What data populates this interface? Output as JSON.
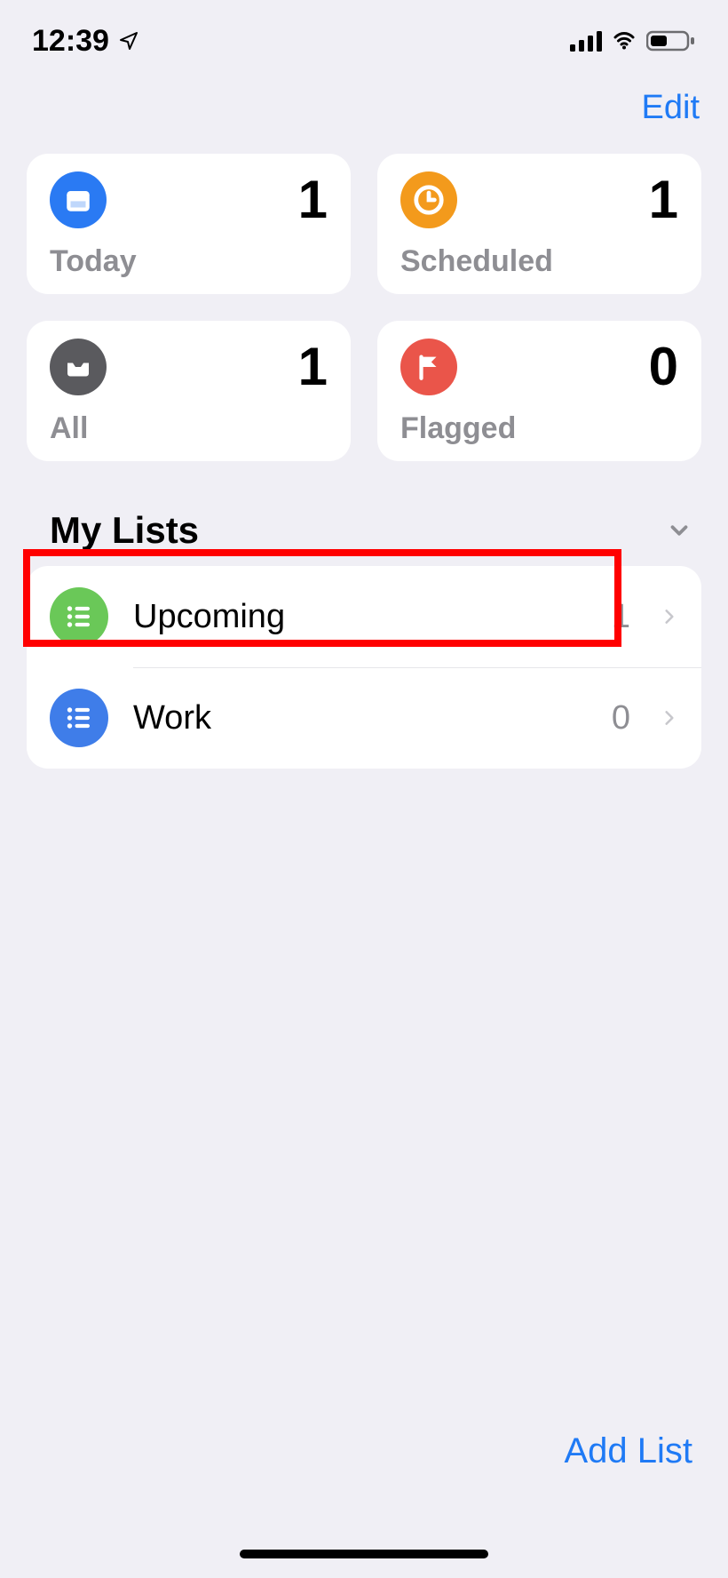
{
  "status": {
    "time": "12:39"
  },
  "header": {
    "edit_label": "Edit"
  },
  "tiles": {
    "today": {
      "label": "Today",
      "count": "1"
    },
    "scheduled": {
      "label": "Scheduled",
      "count": "1"
    },
    "all": {
      "label": "All",
      "count": "1"
    },
    "flagged": {
      "label": "Flagged",
      "count": "0"
    }
  },
  "section": {
    "title": "My Lists"
  },
  "lists": [
    {
      "name": "Upcoming",
      "count": "1",
      "highlighted": true
    },
    {
      "name": "Work",
      "count": "0",
      "highlighted": false
    }
  ],
  "footer": {
    "add_list_label": "Add List"
  }
}
